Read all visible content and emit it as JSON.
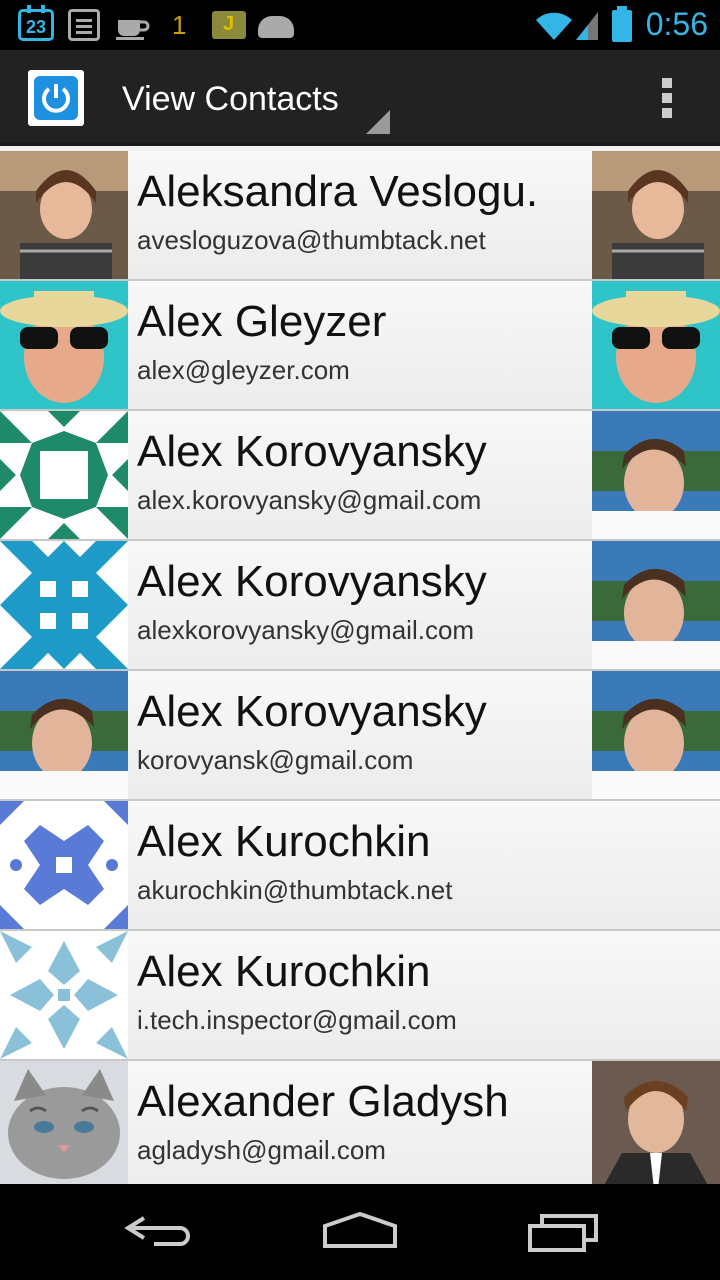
{
  "status_bar": {
    "calendar_day": "23",
    "notification_count": "1",
    "time": "0:56",
    "icons": [
      "calendar-icon",
      "clipboard-icon",
      "coffee-icon",
      "jorte-icon",
      "android-icon",
      "wifi-icon",
      "signal-icon",
      "battery-charging-icon"
    ],
    "accent_color": "#33b5e5"
  },
  "action_bar": {
    "title": "View Contacts",
    "app_icon": "power-icon",
    "overflow_icon": "overflow-menu-icon"
  },
  "contacts": [
    {
      "name": "Aleksandra Veslogu.",
      "email": "avesloguzova@thumbtack.net",
      "avatar": "photo-woman",
      "has_photo": true
    },
    {
      "name": "Alex Gleyzer",
      "email": "alex@gleyzer.com",
      "avatar": "photo-man-hat",
      "has_photo": true
    },
    {
      "name": "Alex Korovyansky",
      "email": "alex.korovyansky@gmail.com",
      "avatar": "identicon-green",
      "has_photo": true
    },
    {
      "name": "Alex Korovyansky",
      "email": "alexkorovyansky@gmail.com",
      "avatar": "identicon-blue",
      "has_photo": true
    },
    {
      "name": "Alex Korovyansky",
      "email": "korovyansk@gmail.com",
      "avatar": "photo-young-man",
      "has_photo": true
    },
    {
      "name": "Alex Kurochkin",
      "email": "akurochkin@thumbtack.net",
      "avatar": "identicon-indigo",
      "has_photo": false
    },
    {
      "name": "Alex Kurochkin",
      "email": "i.tech.inspector@gmail.com",
      "avatar": "identicon-lightblue",
      "has_photo": false
    },
    {
      "name": "Alexander Gladysh",
      "email": "agladysh@gmail.com",
      "avatar": "photo-kitten",
      "has_photo": true
    }
  ],
  "nav_bar": {
    "icons": [
      "back-icon",
      "home-icon",
      "recent-apps-icon"
    ]
  }
}
